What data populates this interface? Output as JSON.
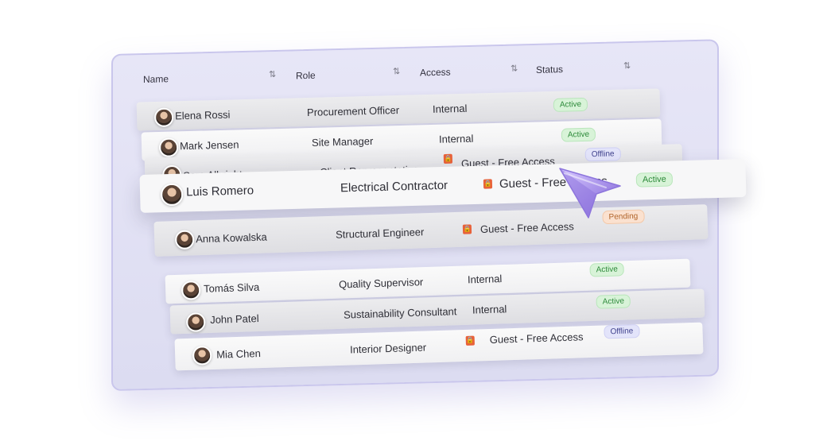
{
  "table": {
    "headers": {
      "name": "Name",
      "role": "Role",
      "access": "Access",
      "status": "Status"
    },
    "sort_icon": "sort-arrow-icon",
    "rows": [
      {
        "name": "Elena Rossi",
        "role": "Procurement Officer",
        "access": "Internal",
        "status": "Active"
      },
      {
        "name": "Mark Jensen",
        "role": "Site Manager",
        "access": "Internal",
        "status": "Active"
      },
      {
        "name": "Sara Albright",
        "role": "Client Representative",
        "access": "Guest - Free Access",
        "status": "Offline"
      },
      {
        "name": "Luis Romero",
        "role": "Electrical Contractor",
        "access": "Guest - Free Access",
        "status": "Active"
      },
      {
        "name": "Anna Kowalska",
        "role": "Structural Engineer",
        "access": "Guest - Free Access",
        "status": "Pending"
      },
      {
        "name": "Tomás Silva",
        "role": "Quality Supervisor",
        "access": "Internal",
        "status": "Active"
      },
      {
        "name": "John Patel",
        "role": "Sustainability Consultant",
        "access": "Internal",
        "status": "Active"
      },
      {
        "name": "Mia Chen",
        "role": "Interior Designer",
        "access": "Guest - Free Access",
        "status": "Offline"
      }
    ]
  },
  "icons": {
    "guest_access": "lock-icon",
    "pointer": "cursor-pointer-icon",
    "user": "avatar-photo"
  },
  "colors": {
    "active": "#2d8a3a",
    "offline": "#41438e",
    "pending": "#b1652b",
    "lock": "#e8623a",
    "panel": "#dcdcf1",
    "cursor": "#a58ee8"
  }
}
